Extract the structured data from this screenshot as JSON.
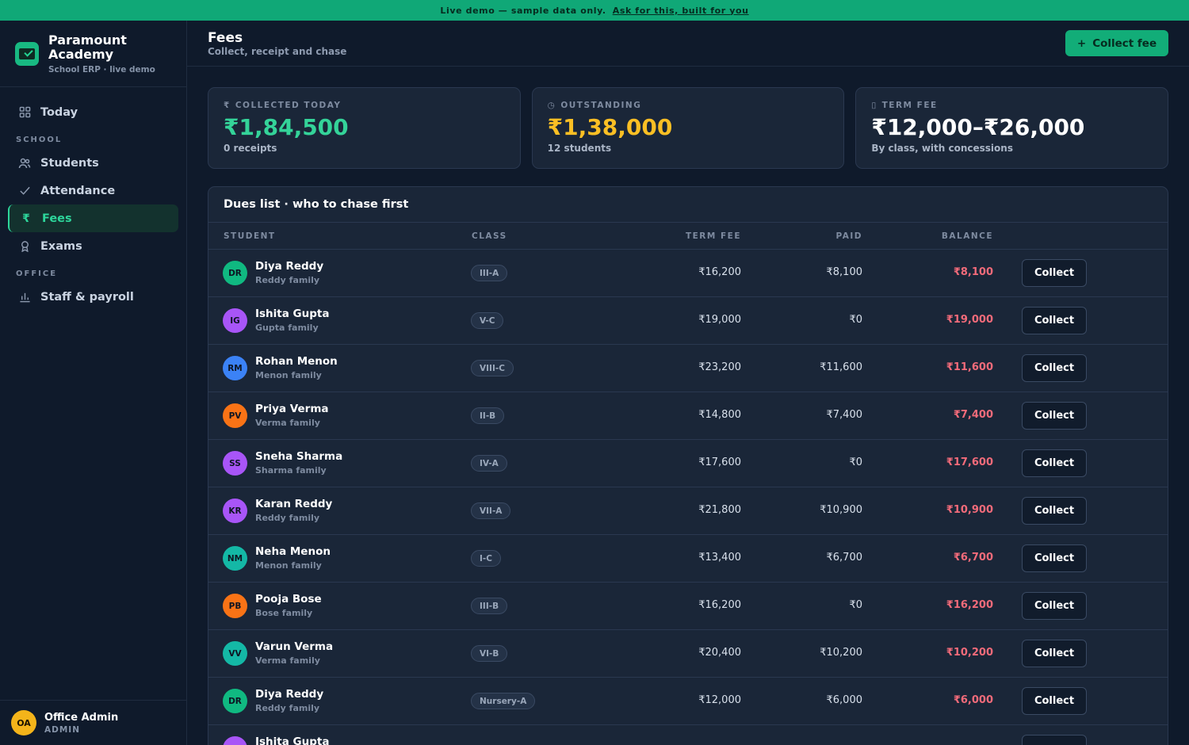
{
  "banner": {
    "text": "Live demo — sample data only.",
    "link": "Ask for this, built for you"
  },
  "brand": {
    "name": "Paramount Academy",
    "sub": "School ERP · live demo"
  },
  "nav": {
    "today": "Today",
    "school_section": "SCHOOL",
    "students": "Students",
    "attendance": "Attendance",
    "fees": "Fees",
    "exams": "Exams",
    "office_section": "OFFICE",
    "staff": "Staff & payroll"
  },
  "user": {
    "initials": "OA",
    "name": "Office Admin",
    "role": "ADMIN"
  },
  "header": {
    "title": "Fees",
    "subtitle": "Collect, receipt and chase",
    "collect_button": "Collect fee",
    "plus_icon": "+"
  },
  "cards": [
    {
      "icon": "₹",
      "label": "COLLECTED TODAY",
      "value": "₹1,84,500",
      "foot": "0 receipts",
      "color": "#34d399"
    },
    {
      "icon": "◷",
      "label": "OUTSTANDING",
      "value": "₹1,38,000",
      "foot": "12 students",
      "color": "#fbbf24"
    },
    {
      "icon": "▯",
      "label": "TERM FEE",
      "value": "₹12,000–₹26,000",
      "foot": "By class, with concessions",
      "color": "#ffffff"
    }
  ],
  "dues": {
    "title": "Dues list · who to chase first",
    "columns": {
      "student": "STUDENT",
      "class": "CLASS",
      "term_fee": "TERM FEE",
      "paid": "PAID",
      "balance": "BALANCE"
    },
    "collect_label": "Collect",
    "rows": [
      {
        "initials": "DR",
        "name": "Diya Reddy",
        "family": "Reddy family",
        "class": "III-A",
        "term_fee": "₹16,200",
        "paid": "₹8,100",
        "balance": "₹8,100",
        "color": "#10b981"
      },
      {
        "initials": "IG",
        "name": "Ishita Gupta",
        "family": "Gupta family",
        "class": "V-C",
        "term_fee": "₹19,000",
        "paid": "₹0",
        "balance": "₹19,000",
        "color": "#a855f7"
      },
      {
        "initials": "RM",
        "name": "Rohan Menon",
        "family": "Menon family",
        "class": "VIII-C",
        "term_fee": "₹23,200",
        "paid": "₹11,600",
        "balance": "₹11,600",
        "color": "#3b82f6"
      },
      {
        "initials": "PV",
        "name": "Priya Verma",
        "family": "Verma family",
        "class": "II-B",
        "term_fee": "₹14,800",
        "paid": "₹7,400",
        "balance": "₹7,400",
        "color": "#f97316"
      },
      {
        "initials": "SS",
        "name": "Sneha Sharma",
        "family": "Sharma family",
        "class": "IV-A",
        "term_fee": "₹17,600",
        "paid": "₹0",
        "balance": "₹17,600",
        "color": "#a855f7"
      },
      {
        "initials": "KR",
        "name": "Karan Reddy",
        "family": "Reddy family",
        "class": "VII-A",
        "term_fee": "₹21,800",
        "paid": "₹10,900",
        "balance": "₹10,900",
        "color": "#a855f7"
      },
      {
        "initials": "NM",
        "name": "Neha Menon",
        "family": "Menon family",
        "class": "I-C",
        "term_fee": "₹13,400",
        "paid": "₹6,700",
        "balance": "₹6,700",
        "color": "#14b8a6"
      },
      {
        "initials": "PB",
        "name": "Pooja Bose",
        "family": "Bose family",
        "class": "III-B",
        "term_fee": "₹16,200",
        "paid": "₹0",
        "balance": "₹16,200",
        "color": "#f97316"
      },
      {
        "initials": "VV",
        "name": "Varun Verma",
        "family": "Verma family",
        "class": "VI-B",
        "term_fee": "₹20,400",
        "paid": "₹10,200",
        "balance": "₹10,200",
        "color": "#14b8a6"
      },
      {
        "initials": "DR",
        "name": "Diya Reddy",
        "family": "Reddy family",
        "class": "Nursery-A",
        "term_fee": "₹12,000",
        "paid": "₹6,000",
        "balance": "₹6,000",
        "color": "#10b981"
      },
      {
        "initials": "IG",
        "name": "Ishita Gupta",
        "family": "",
        "class": "",
        "term_fee": "",
        "paid": "",
        "balance": "",
        "color": "#a855f7"
      }
    ]
  }
}
